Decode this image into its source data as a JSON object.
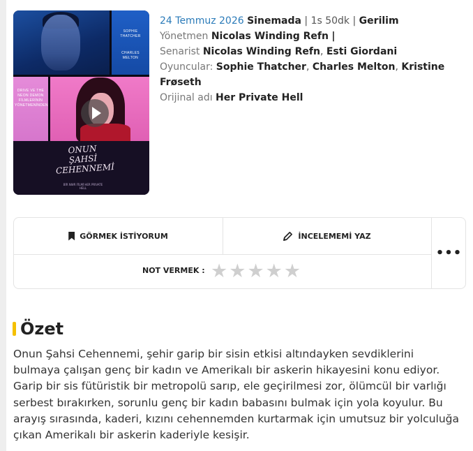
{
  "movie": {
    "release_date": "24 Temmuz 2026",
    "release_status": "Sinemada",
    "separator": "|",
    "duration": "1s 50dk",
    "genre": "Gerilim",
    "director_label": "Yönetmen",
    "director": "Nicolas Winding Refn",
    "director_trailing": "|",
    "writer_label": "Senarist",
    "writers": [
      "Nicolas Winding Refn",
      "Esti Giordani"
    ],
    "cast_label": "Oyuncular:",
    "cast": [
      "Sophie Thatcher",
      "Charles Melton",
      "Kristine Frøseth"
    ],
    "original_title_label": "Orijinal adı",
    "original_title": "Her Private Hell",
    "poster": {
      "name_1": "SOPHIE THATCHER",
      "name_2": "CHARLES MELTON",
      "tagline": "DRIVE VE THE NEON DEMON FİLMLERİNİN YÖNETMENİNDEN",
      "title": "ONUN ŞAHSİ CEHENNEMİ",
      "credit": "BİR NWR FİLMİ HER PRIVATE HELL"
    }
  },
  "actions": {
    "want_to_watch": "GÖRMEK İSTİYORUM",
    "write_review": "İNCELEMEMİ YAZ",
    "more": "•••",
    "rate_label": "NOT VERMEK :",
    "rating": {
      "value": 0,
      "max": 5
    }
  },
  "summary": {
    "title": "Özet",
    "text": "Onun Şahsi Cehennemi, şehir garip bir sisin etkisi altındayken sevdiklerini bulmaya çalışan genç bir kadın ve Amerikalı bir askerin hikayesini konu ediyor. Garip bir sis fütüristik bir metropolü sarıp, ele geçirilmesi zor, ölümcül bir varlığı serbest bırakırken, sorunlu genç bir kadın babasını bulmak için yola koyulur. Bu arayış sırasında, kaderi, kızını cehennemden kurtarmak için umutsuz bir yolculuğa çıkan Amerikalı bir askerin kaderiyle kesişir."
  },
  "colors": {
    "accent_yellow": "#f5c000",
    "date_blue": "#2b7bb9",
    "star_inactive": "#cfcfcf"
  }
}
